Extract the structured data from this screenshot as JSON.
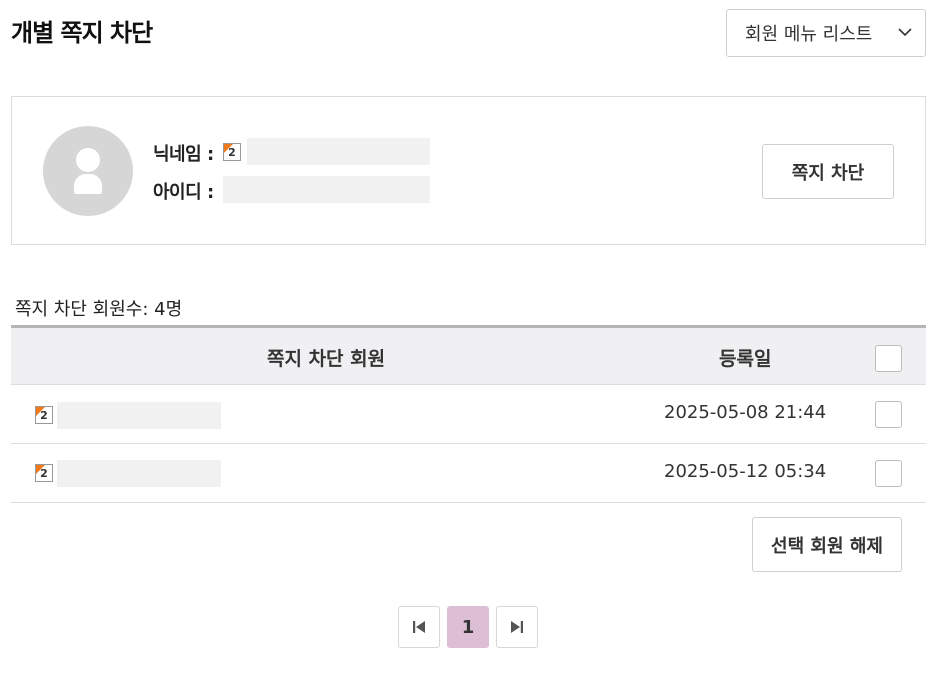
{
  "page": {
    "title": "개별 쪽지 차단"
  },
  "menu_select": {
    "label": "회원 메뉴 리스트",
    "icon": "chevron-down-icon"
  },
  "profile": {
    "nickname_label": "닉네임 :",
    "id_label": "아이디 :",
    "level_icon": "2",
    "block_button": "쪽지 차단"
  },
  "list": {
    "count_label": "쪽지 차단 회원수: 4명",
    "headers": {
      "member": "쪽지 차단 회원",
      "date": "등록일"
    },
    "rows": [
      {
        "level": "2",
        "date": "2025-05-08 21:44"
      },
      {
        "level": "2",
        "date": "2025-05-12 05:34"
      }
    ],
    "release_button": "선택 회원 해제"
  },
  "pagination": {
    "current": "1"
  },
  "colors": {
    "current_page_bg": "#dcbfd5",
    "level_icon_accent": "#f07a1a"
  }
}
